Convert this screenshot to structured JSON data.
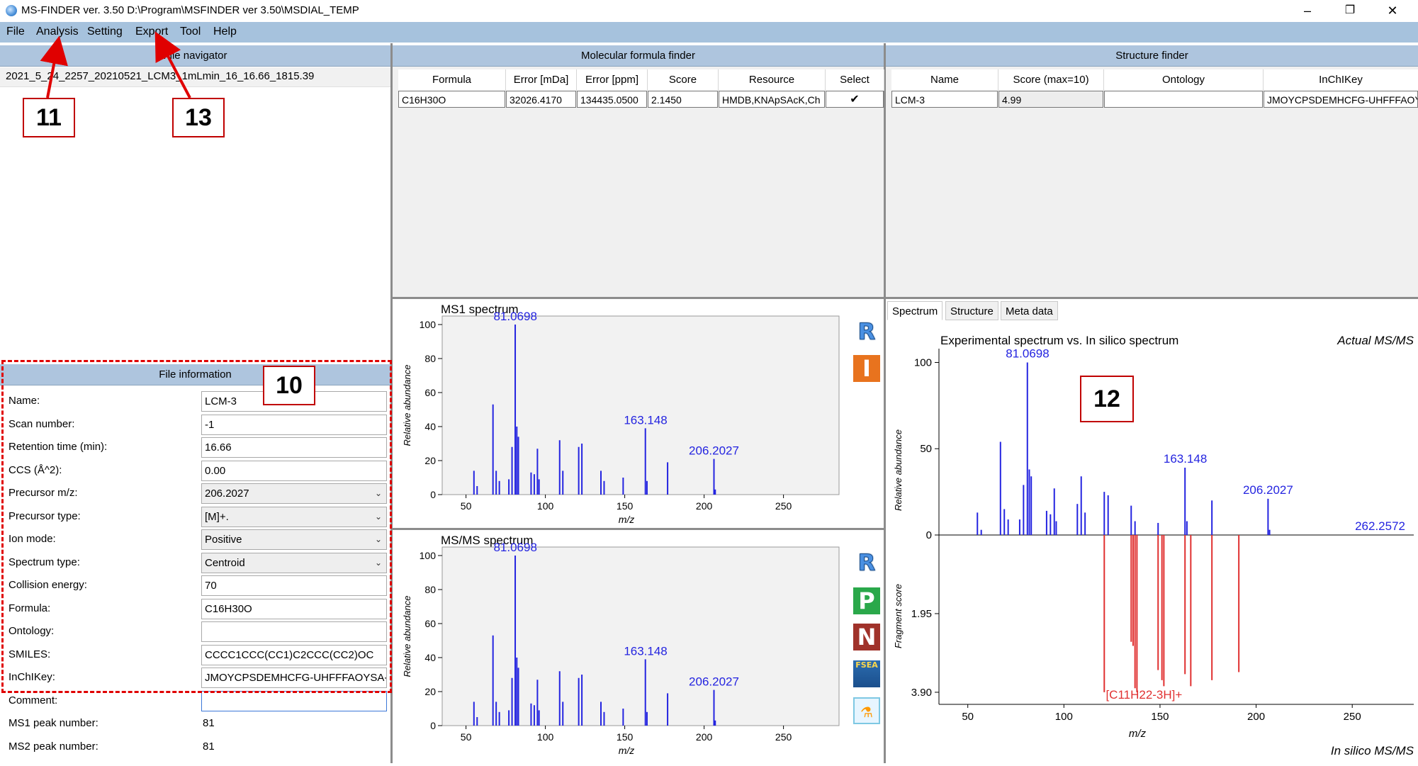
{
  "window": {
    "title": "MS-FINDER ver. 3.50 D:\\Program\\MSFINDER ver 3.50\\MSDIAL_TEMP",
    "minimize": "–",
    "restore": "❐",
    "close": "✕"
  },
  "menu": [
    "File",
    "Analysis",
    "Setting",
    "Export",
    "Tool",
    "Help"
  ],
  "file_navigator": {
    "title": "File navigator",
    "items": [
      "2021_5_24_2257_20210521_LCM3_1mLmin_16_16.66_1815.39"
    ]
  },
  "file_information": {
    "title": "File information",
    "fields": [
      {
        "label": "Name:",
        "value": "LCM-3",
        "kind": "text"
      },
      {
        "label": "Scan number:",
        "value": "-1",
        "kind": "text"
      },
      {
        "label": "Retention time (min):",
        "value": "16.66",
        "kind": "text"
      },
      {
        "label": "CCS (Å^2):",
        "value": "0.00",
        "kind": "text"
      },
      {
        "label": "Precursor m/z:",
        "value": "206.2027",
        "kind": "combo"
      },
      {
        "label": "Precursor type:",
        "value": "[M]+.",
        "kind": "combo"
      },
      {
        "label": "Ion mode:",
        "value": "Positive",
        "kind": "combo"
      },
      {
        "label": "Spectrum type:",
        "value": "Centroid",
        "kind": "combo"
      },
      {
        "label": "Collision energy:",
        "value": "70",
        "kind": "text"
      },
      {
        "label": "Formula:",
        "value": "C16H30O",
        "kind": "text"
      },
      {
        "label": "Ontology:",
        "value": "",
        "kind": "text"
      },
      {
        "label": "SMILES:",
        "value": "CCCC1CCC(CC1)C2CCC(CC2)OC",
        "kind": "text"
      },
      {
        "label": "InChIKey:",
        "value": "JMOYCPSDEMHCFG-UHFFFAOYSA-N",
        "kind": "text"
      },
      {
        "label": "Comment:",
        "value": "",
        "kind": "text"
      },
      {
        "label": "MS1 peak number:",
        "value": "81",
        "kind": "static"
      },
      {
        "label": "MS2 peak number:",
        "value": "81",
        "kind": "static"
      }
    ]
  },
  "formula_finder": {
    "title": "Molecular formula finder",
    "columns": [
      "Formula",
      "Error [mDa]",
      "Error [ppm]",
      "Score",
      "Resource",
      "Select"
    ],
    "rows": [
      [
        "C16H30O",
        "32026.4170",
        "134435.0500",
        "2.1450",
        "HMDB,KNApSAcK,Ch",
        "✔"
      ]
    ]
  },
  "structure_finder": {
    "title": "Structure finder",
    "columns": [
      "Name",
      "Score (max=10)",
      "Ontology",
      "InChIKey"
    ],
    "rows": [
      [
        "LCM-3",
        "4.99",
        "",
        "JMOYCPSDEMHCFG-UHFFFAOYSA-N"
      ]
    ]
  },
  "tabs": [
    "Spectrum",
    "Structure",
    "Meta data"
  ],
  "side_buttons_ms1": [
    {
      "label": "R",
      "icon": "reference-icon",
      "color": "#4a90e2"
    },
    {
      "label": "I",
      "icon": "isotope-icon",
      "color": "#e8731e"
    }
  ],
  "side_buttons_ms2": [
    {
      "label": "R",
      "icon": "reference-icon",
      "color": "#4a90e2"
    },
    {
      "label": "P",
      "icon": "p-icon",
      "color": "#2aa84a"
    },
    {
      "label": "N",
      "icon": "n-icon",
      "color": "#a0322a"
    },
    {
      "label": "FSEA",
      "icon": "fsea-icon",
      "color": "#2b6cb0"
    },
    {
      "label": "",
      "icon": "tool-icon",
      "color": "#7ec8e3"
    }
  ],
  "annotations": [
    "11",
    "13",
    "10",
    "12"
  ],
  "colors": {
    "accent": "#a6c2dd",
    "header": "#aec5de",
    "annotation": "#e00000",
    "ms_blue": "#2424e0",
    "insilico_red": "#e03030"
  },
  "chart_data": [
    {
      "id": "ms1",
      "type": "bar",
      "title": "MS1 spectrum",
      "xlabel": "m/z",
      "ylabel": "Relative abundance",
      "xlim": [
        35,
        285
      ],
      "ylim": [
        0,
        105
      ],
      "xticks": [
        50,
        100,
        150,
        200,
        250
      ],
      "yticks": [
        0,
        20,
        40,
        60,
        80,
        100
      ],
      "peaks": [
        [
          55,
          14
        ],
        [
          57,
          5
        ],
        [
          67,
          53
        ],
        [
          69,
          14
        ],
        [
          71,
          8
        ],
        [
          77,
          9
        ],
        [
          79,
          28
        ],
        [
          81,
          100
        ],
        [
          82,
          40
        ],
        [
          83,
          34
        ],
        [
          91,
          13
        ],
        [
          93,
          12
        ],
        [
          95,
          27
        ],
        [
          96,
          9
        ],
        [
          109,
          32
        ],
        [
          111,
          14
        ],
        [
          121,
          28
        ],
        [
          123,
          30
        ],
        [
          135,
          14
        ],
        [
          137,
          8
        ],
        [
          149,
          10
        ],
        [
          163,
          39
        ],
        [
          164,
          8
        ],
        [
          177,
          19
        ],
        [
          206.2,
          21
        ],
        [
          207,
          3
        ]
      ],
      "labels": [
        {
          "x": 81.0698,
          "y": 100,
          "text": "81.0698"
        },
        {
          "x": 163.148,
          "y": 39,
          "text": "163.148"
        },
        {
          "x": 206.2027,
          "y": 21,
          "text": "206.2027"
        }
      ]
    },
    {
      "id": "ms2",
      "type": "bar",
      "title": "MS/MS spectrum",
      "xlabel": "m/z",
      "ylabel": "Relative abundance",
      "xlim": [
        35,
        285
      ],
      "ylim": [
        0,
        105
      ],
      "xticks": [
        50,
        100,
        150,
        200,
        250
      ],
      "yticks": [
        0,
        20,
        40,
        60,
        80,
        100
      ],
      "peaks": [
        [
          55,
          14
        ],
        [
          57,
          5
        ],
        [
          67,
          53
        ],
        [
          69,
          14
        ],
        [
          71,
          8
        ],
        [
          77,
          9
        ],
        [
          79,
          28
        ],
        [
          81,
          100
        ],
        [
          82,
          40
        ],
        [
          83,
          34
        ],
        [
          91,
          13
        ],
        [
          93,
          12
        ],
        [
          95,
          27
        ],
        [
          96,
          9
        ],
        [
          109,
          32
        ],
        [
          111,
          14
        ],
        [
          121,
          28
        ],
        [
          123,
          30
        ],
        [
          135,
          14
        ],
        [
          137,
          8
        ],
        [
          149,
          10
        ],
        [
          163,
          39
        ],
        [
          164,
          8
        ],
        [
          177,
          19
        ],
        [
          206.2,
          21
        ],
        [
          207,
          3
        ]
      ],
      "labels": [
        {
          "x": 81.0698,
          "y": 100,
          "text": "81.0698"
        },
        {
          "x": 163.148,
          "y": 39,
          "text": "163.148"
        },
        {
          "x": 206.2027,
          "y": 21,
          "text": "206.2027"
        }
      ]
    },
    {
      "id": "mirror",
      "type": "bar",
      "title": "Experimental spectrum vs. In silico spectrum",
      "top_tag": "Actual MS/MS",
      "bottom_tag": "In silico MS/MS",
      "xlabel": "m/z",
      "ylabel_top": "Relative abundance",
      "ylabel_bottom": "Fragment score",
      "xlim": [
        35,
        282
      ],
      "xticks": [
        50,
        100,
        150,
        200,
        250
      ],
      "yticks_top": [
        0,
        50,
        100
      ],
      "yticks_bottom": [
        "1.95",
        "3.90"
      ],
      "peaks": [
        [
          55,
          13
        ],
        [
          57,
          3
        ],
        [
          67,
          54
        ],
        [
          69,
          15
        ],
        [
          71,
          9
        ],
        [
          77,
          9
        ],
        [
          79,
          29
        ],
        [
          81,
          100
        ],
        [
          82,
          38
        ],
        [
          83,
          34
        ],
        [
          91,
          14
        ],
        [
          93,
          12
        ],
        [
          95,
          27
        ],
        [
          96,
          8
        ],
        [
          107,
          18
        ],
        [
          109,
          34
        ],
        [
          111,
          13
        ],
        [
          121,
          25
        ],
        [
          123,
          23
        ],
        [
          135,
          17
        ],
        [
          137,
          8
        ],
        [
          149,
          7
        ],
        [
          163,
          39
        ],
        [
          164,
          8
        ],
        [
          177,
          20
        ],
        [
          206.2,
          21
        ],
        [
          207,
          3
        ]
      ],
      "insilico": [
        [
          121,
          3.9
        ],
        [
          135,
          2.65
        ],
        [
          136,
          2.75
        ],
        [
          137,
          3.8
        ],
        [
          138,
          3.9
        ],
        [
          149,
          3.35
        ],
        [
          151,
          3.6
        ],
        [
          152,
          3.75
        ],
        [
          163,
          3.45
        ],
        [
          166,
          3.75
        ],
        [
          177,
          3.6
        ],
        [
          191,
          3.4
        ]
      ],
      "labels": [
        {
          "x": 81.0698,
          "y": 100,
          "text": "81.0698"
        },
        {
          "x": 163.148,
          "y": 39,
          "text": "163.148"
        },
        {
          "x": 206.2027,
          "y": 21,
          "text": "206.2027"
        },
        {
          "x": 262.2572,
          "y": 0,
          "text": "262.2572"
        }
      ],
      "insilico_label": "[C11H22-3H]+"
    }
  ]
}
